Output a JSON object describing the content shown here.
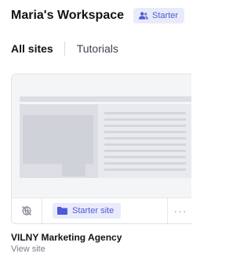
{
  "workspace": {
    "title": "Maria's Workspace",
    "plan_label": "Starter",
    "plan_icon": "users-icon",
    "accent_color": "#4d5bd6",
    "accent_bg": "#e9ebfb"
  },
  "tabs": [
    {
      "label": "All sites",
      "active": true
    },
    {
      "label": "Tutorials",
      "active": false
    }
  ],
  "site_card": {
    "thumbnail": "website-wireframe-thumbnail",
    "status_icon": "unpublished-globe-icon",
    "plan_badge_label": "Starter site",
    "plan_badge_icon": "folder-icon",
    "more_icon": "more-horizontal-icon",
    "more_glyph": "···",
    "name": "VILNY Marketing Agency",
    "link_label": "View site"
  }
}
